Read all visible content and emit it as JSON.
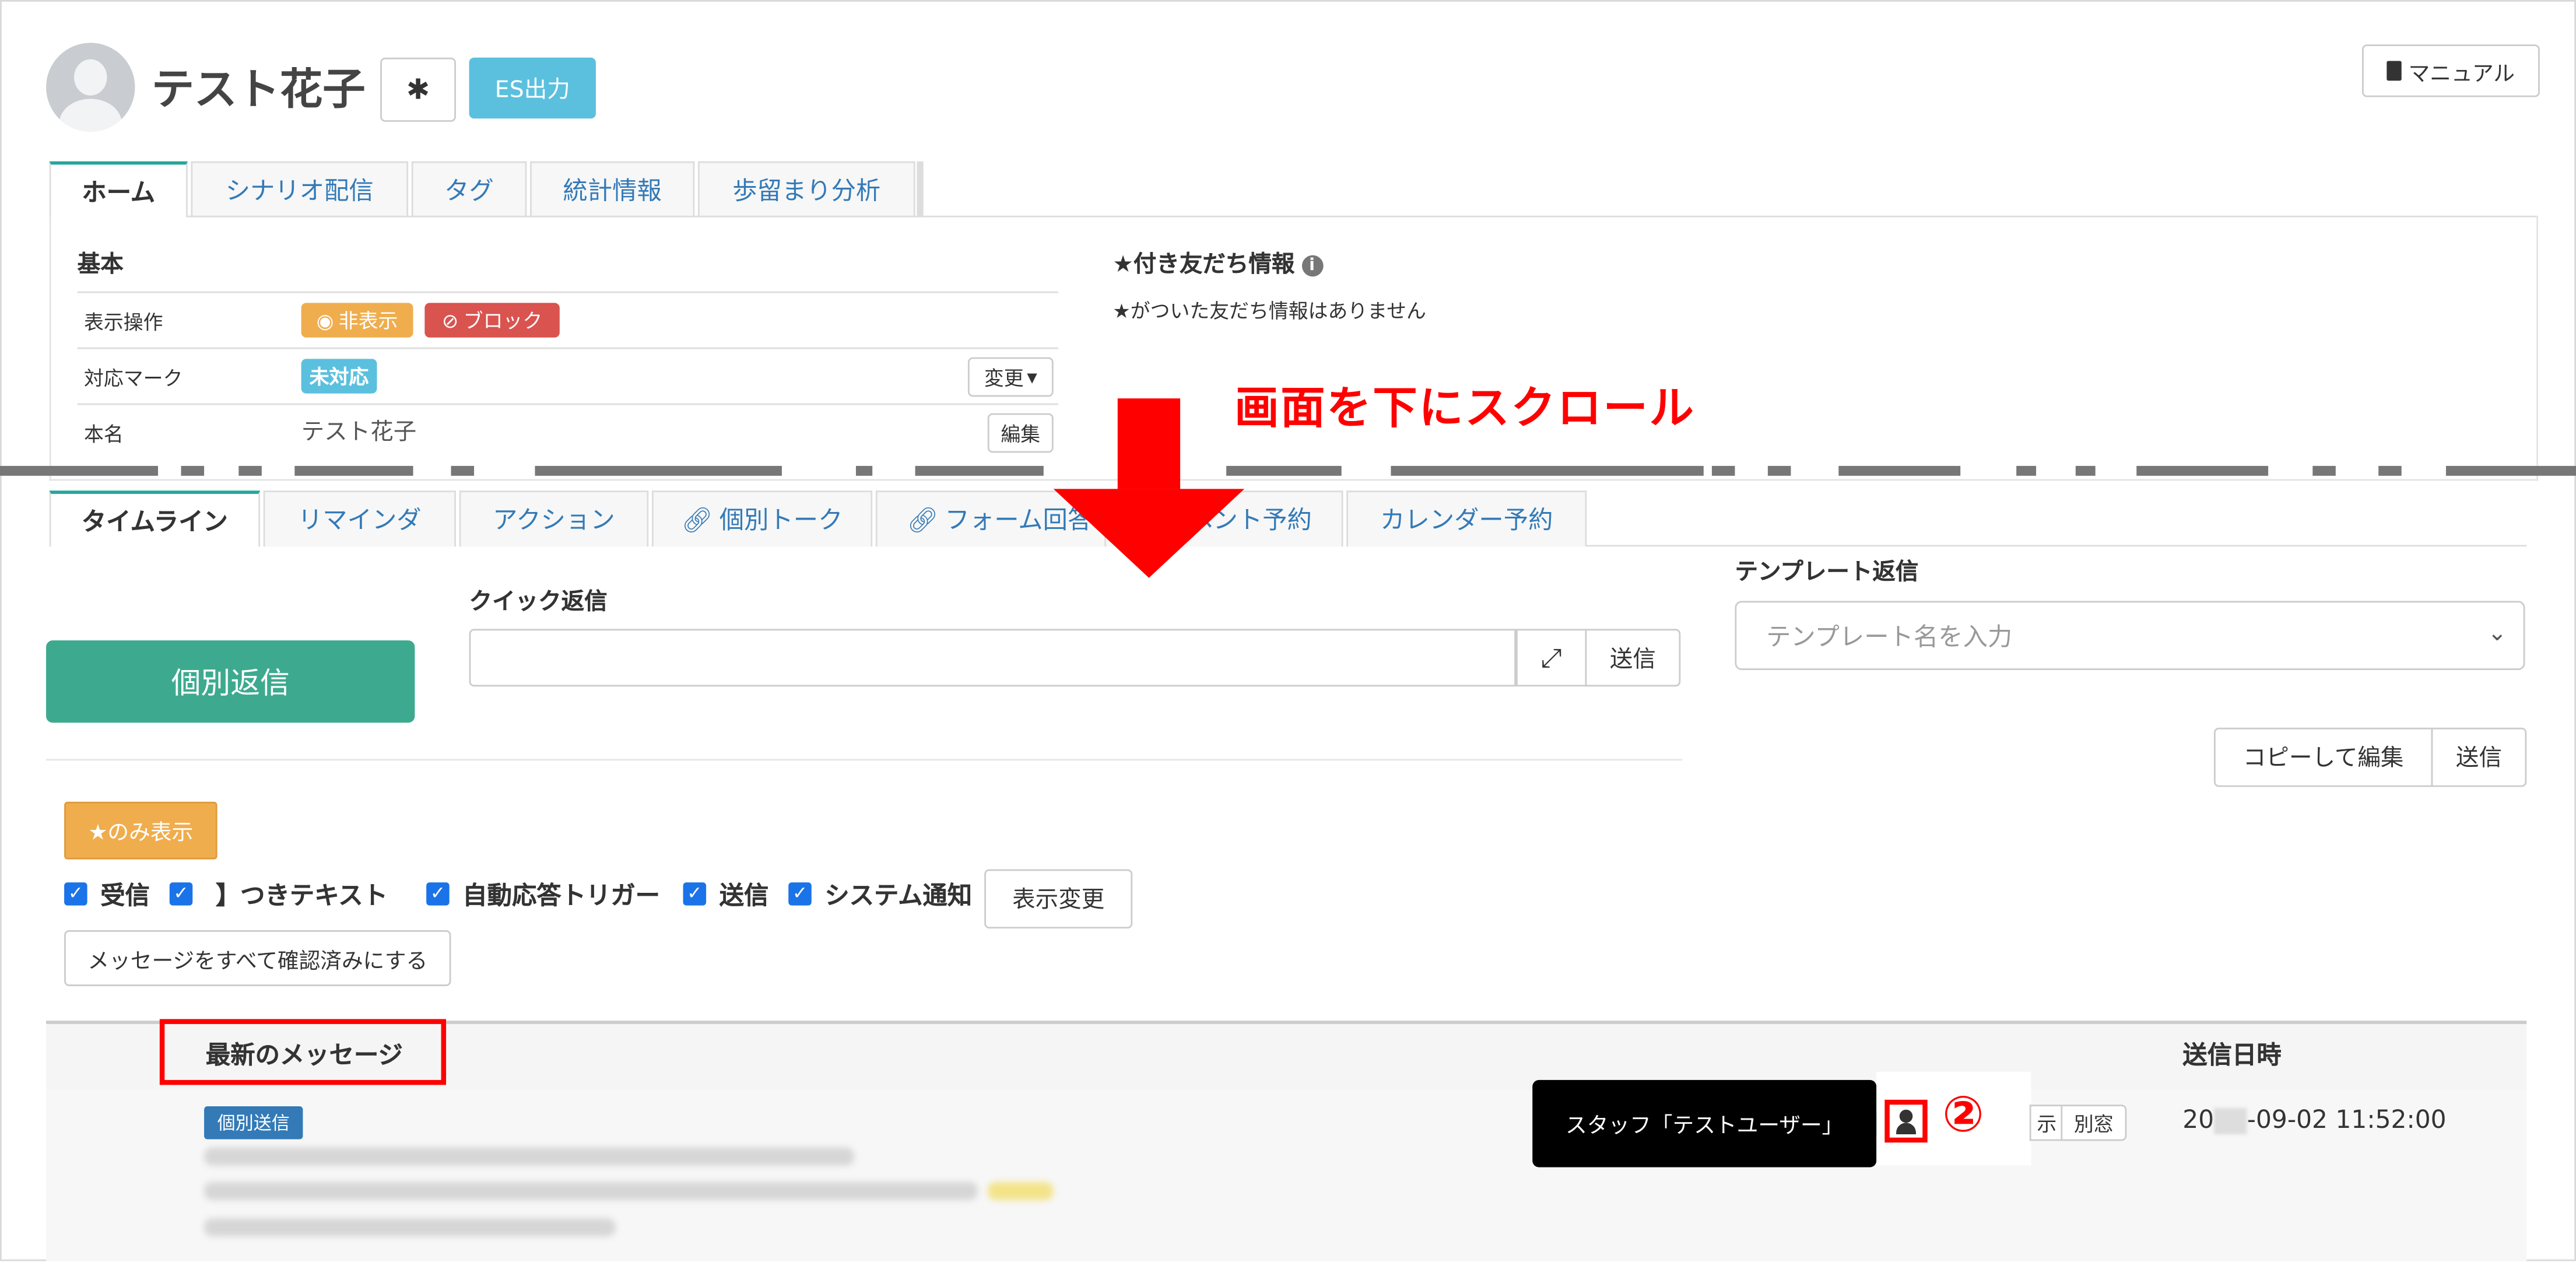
{
  "header": {
    "name": "テスト花子",
    "es_button": "ES出力",
    "manual_button": "マニュアル"
  },
  "top_tabs": [
    "ホーム",
    "シナリオ配信",
    "タグ",
    "統計情報",
    "歩留まり分析"
  ],
  "basic": {
    "title": "基本",
    "rows": [
      {
        "label": "表示操作"
      },
      {
        "label": "対応マーク"
      },
      {
        "label": "本名",
        "value": "テスト花子"
      }
    ],
    "hide_badge": "非表示",
    "block_badge": "ブロック",
    "status_badge": "未対応",
    "change_button": "変更",
    "edit_button": "編集"
  },
  "star_info": {
    "title": "★付き友だち情報",
    "empty_text": "★がついた友だち情報はありません"
  },
  "annotation": {
    "scroll_text": "画面を下にスクロール",
    "step_marker": "②"
  },
  "bottom_tabs": [
    "タイムライン",
    "リマインダ",
    "アクション",
    "個別トーク",
    "フォーム回答",
    "ベント予約",
    "カレンダー予約"
  ],
  "reply": {
    "individual_reply_button": "個別返信",
    "quick_reply_label": "クイック返信",
    "send_button": "送信",
    "template_label": "テンプレート返信",
    "template_placeholder": "テンプレート名を入力",
    "copy_edit_button": "コピーして編集",
    "template_send_button": "送信"
  },
  "filters": {
    "star_only_button": "★のみ表示",
    "checkboxes": [
      "受信",
      "】つきテキスト",
      "自動応答トリガー",
      "送信",
      "システム通知"
    ],
    "apply_button": "表示変更",
    "mark_all_read_button": "メッセージをすべて確認済みにする"
  },
  "table": {
    "col_latest": "最新のメッセージ",
    "col_sent_at": "送信日時",
    "row_tag": "個別送信",
    "tooltip": "スタッフ「テストユーザー」",
    "partial_btn": "示",
    "separate_window_btn": "別窓",
    "sent_at_prefix": "20",
    "sent_at_suffix": "-09-02 11:52:00"
  }
}
